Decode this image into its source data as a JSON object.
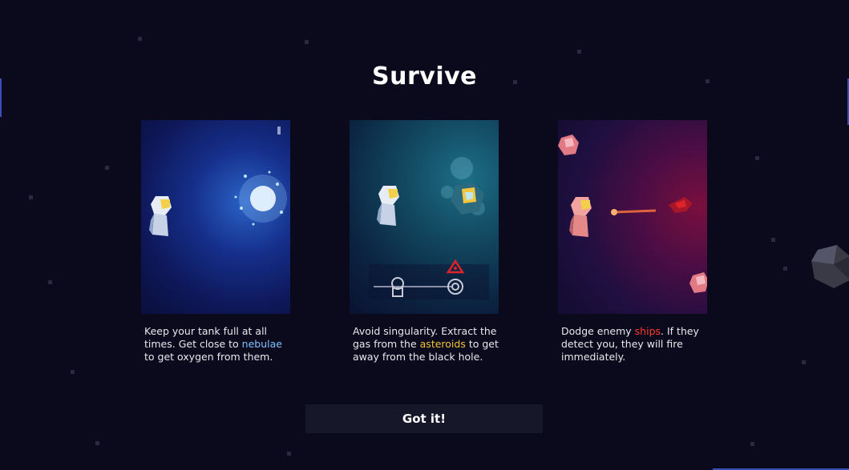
{
  "title": "Survive",
  "cards": [
    {
      "pre": "Keep your tank full at all times. Get close to ",
      "highlight": "nebulae",
      "post": " to get oxygen from them.",
      "icon": "astronaut-icon"
    },
    {
      "pre": "Avoid singularity. Extract the gas from the ",
      "highlight": "asteroids",
      "post": " to get away from the black hole.",
      "icon": "asteroid-icon"
    },
    {
      "pre": "Dodge enemy ",
      "highlight": "ships",
      "post": ". If they detect you, they will fire immediately.",
      "icon": "enemy-ship-icon"
    }
  ],
  "button_label": "Got it!",
  "colors": {
    "background": "#0b0a1c",
    "nebula": "#7fc0ff",
    "asteroid": "#f2c23a",
    "enemy": "#ff3b2f",
    "button": "#17172a"
  }
}
